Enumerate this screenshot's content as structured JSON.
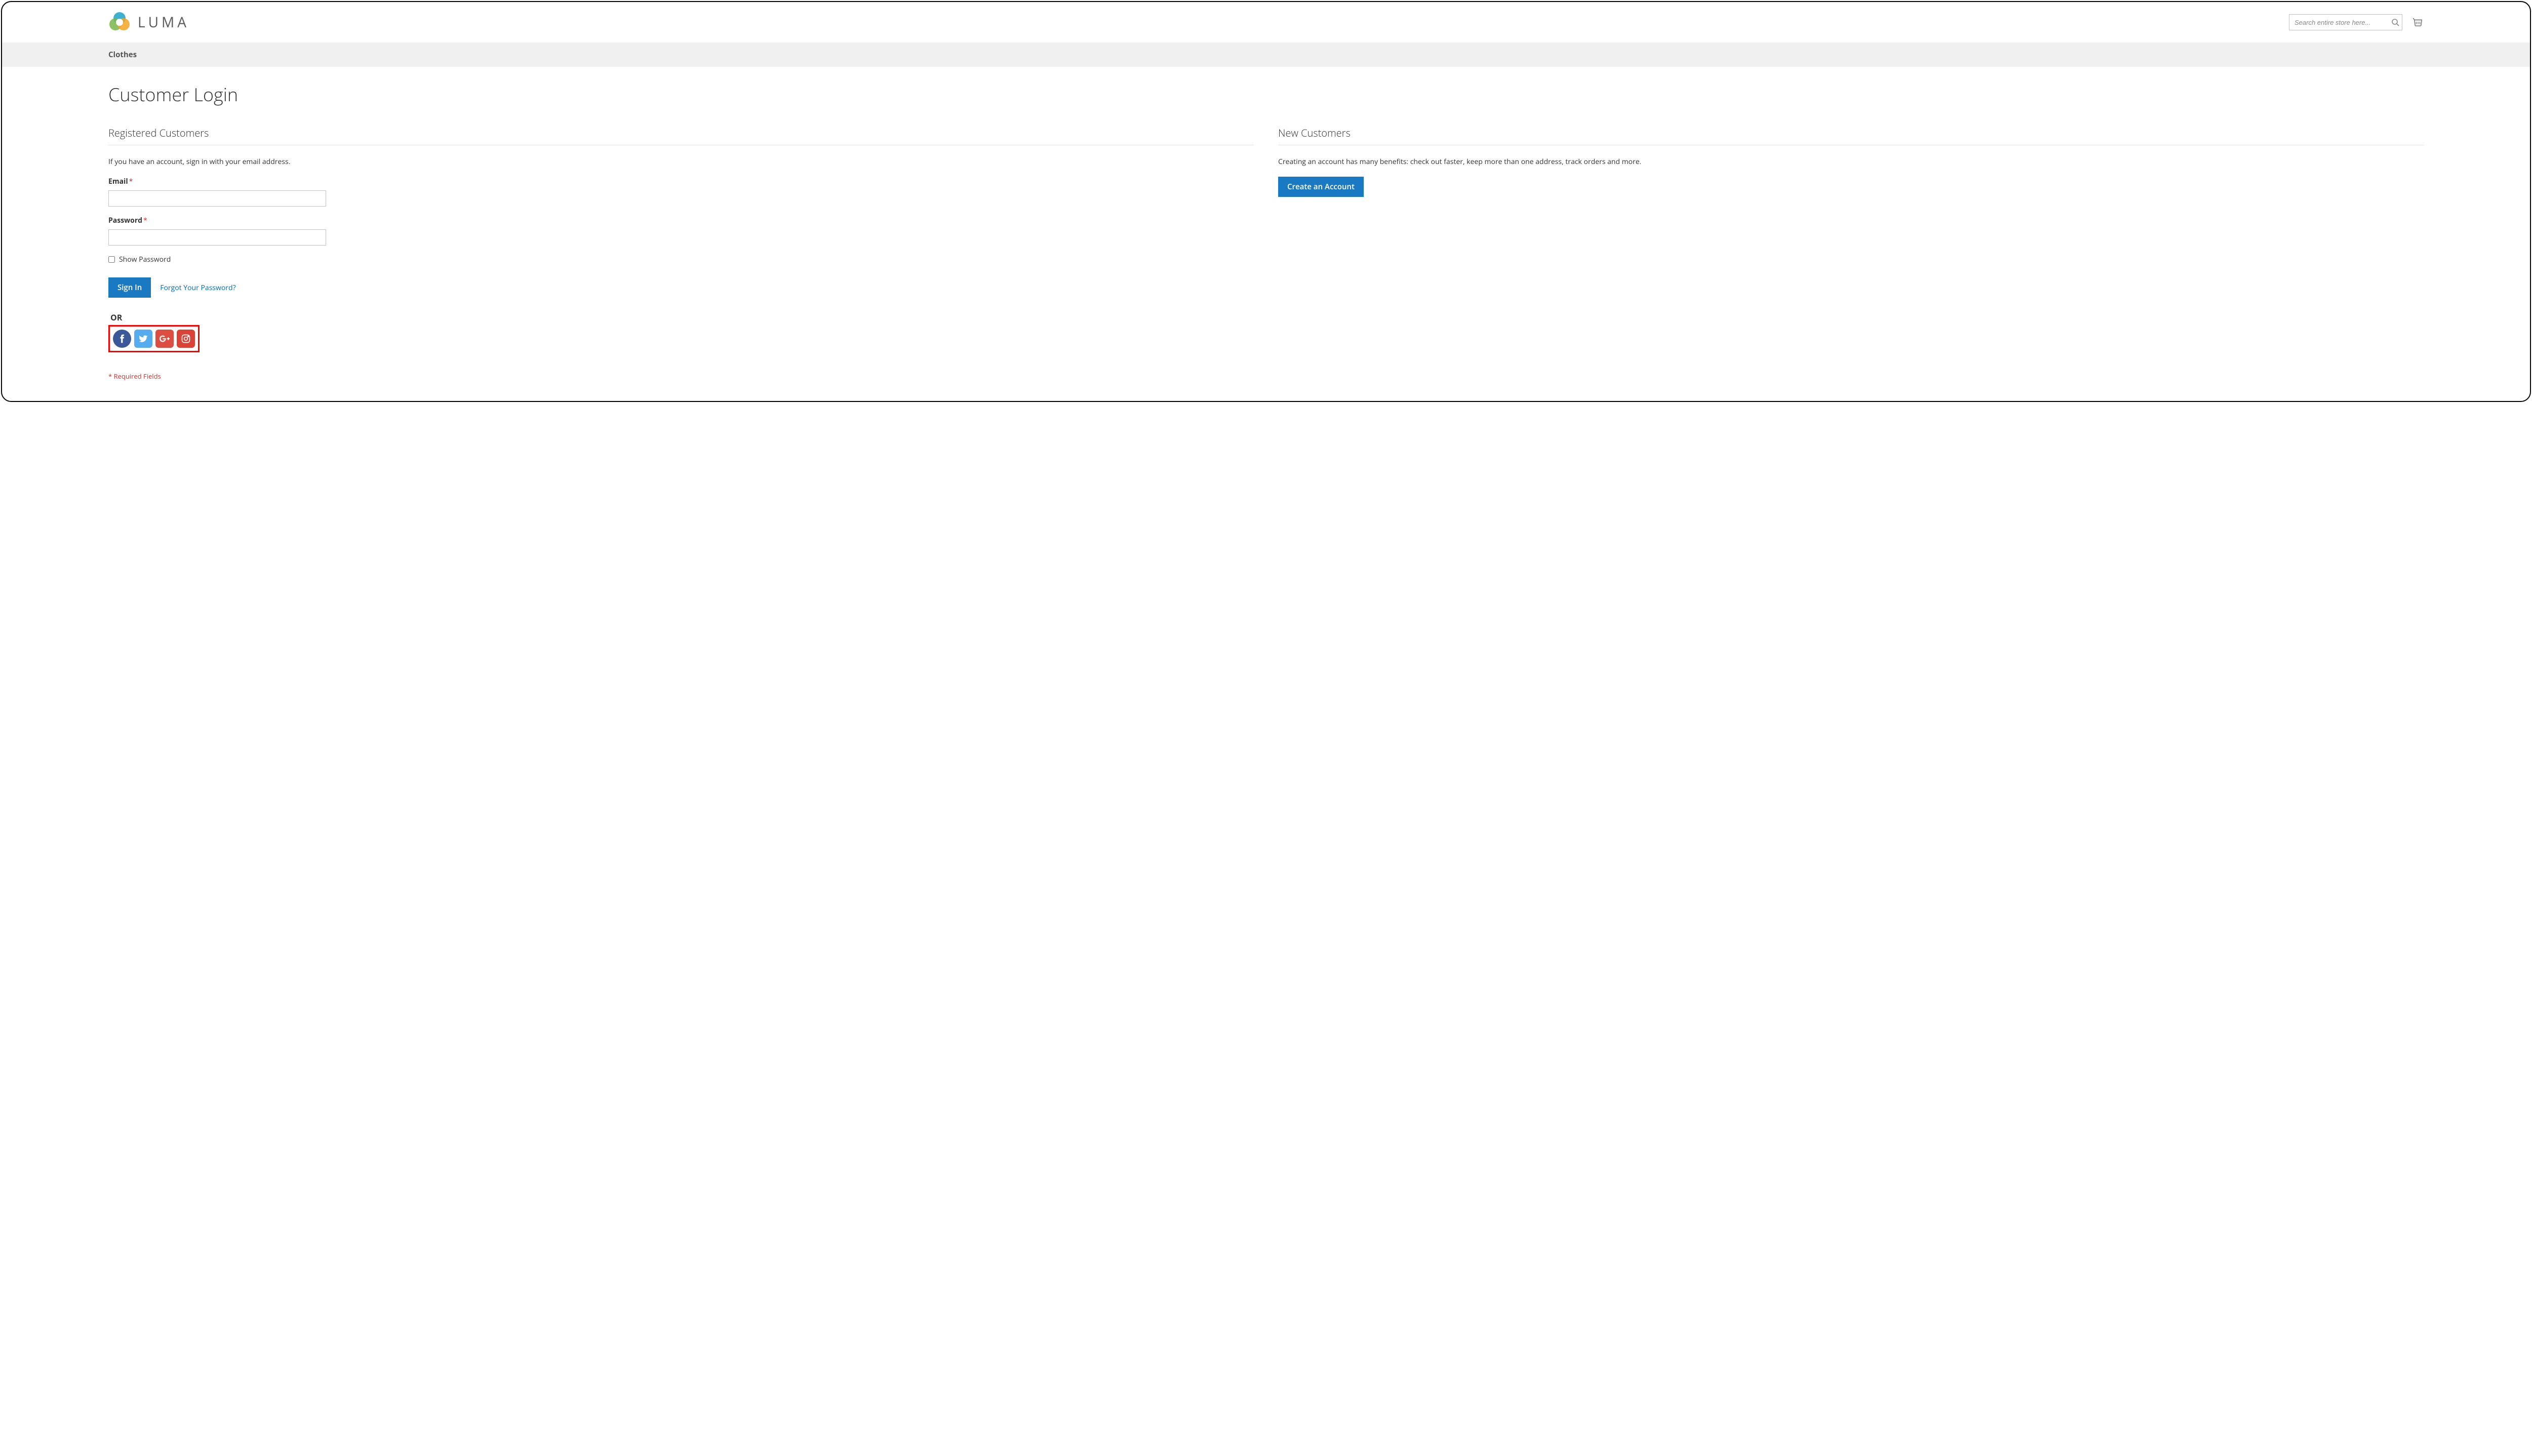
{
  "brand": "LUMA",
  "search": {
    "placeholder": "Search entire store here..."
  },
  "nav": {
    "item1": "Clothes"
  },
  "page": {
    "title": "Customer Login"
  },
  "registered": {
    "heading": "Registered Customers",
    "desc": "If you have an account, sign in with your email address.",
    "email_label": "Email",
    "password_label": "Password",
    "show_password_label": "Show Password",
    "signin_label": "Sign In",
    "forgot_label": "Forgot Your Password?",
    "or_label": "OR",
    "required_note": "* Required Fields"
  },
  "newcust": {
    "heading": "New Customers",
    "desc": "Creating an account has many benefits: check out faster, keep more than one address, track orders and more.",
    "create_label": "Create an Account"
  },
  "social": {
    "fb": "facebook",
    "tw": "twitter",
    "gp": "google-plus",
    "ig": "instagram"
  }
}
